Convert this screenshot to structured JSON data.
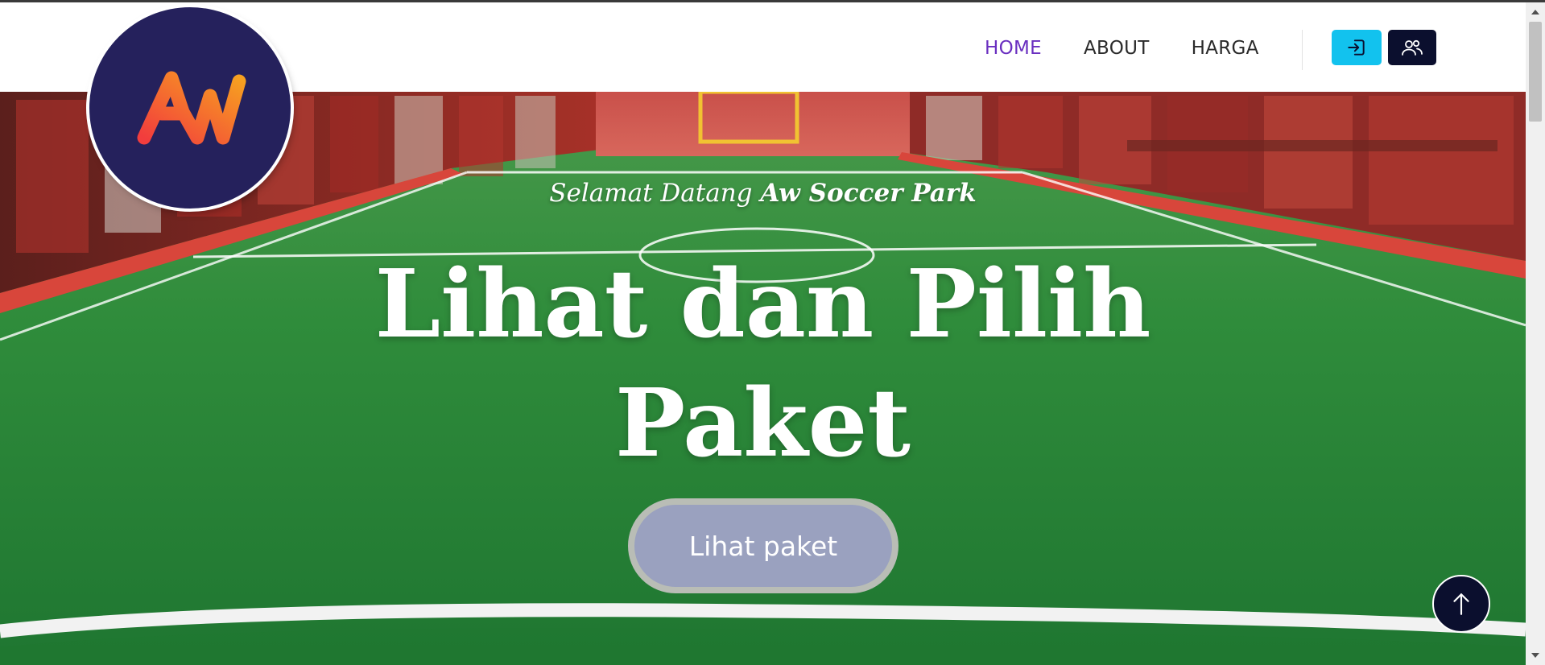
{
  "nav": {
    "links": [
      {
        "label": "HOME",
        "active": true
      },
      {
        "label": "ABOUT",
        "active": false
      },
      {
        "label": "HARGA",
        "active": false
      }
    ],
    "login_icon": "login-icon",
    "register_icon": "users-icon"
  },
  "logo": {
    "text": "AW",
    "background": "#25215c",
    "accent_from": "#f23d3d",
    "accent_to": "#f7a020"
  },
  "hero": {
    "welcome_prefix": "Selamat Datang",
    "welcome_brand": "Aw Soccer Park",
    "headline_line1": "Lihat dan Pilih",
    "headline_line2": "Paket",
    "cta_label": "Lihat paket"
  },
  "back_to_top_icon": "arrow-up-icon",
  "colors": {
    "active_nav": "#6a2fc0",
    "login_button": "#12c2ee",
    "register_button": "#0b0f2e",
    "cta_background": "#9aa1bf",
    "cta_border": "#b9bdb6"
  }
}
